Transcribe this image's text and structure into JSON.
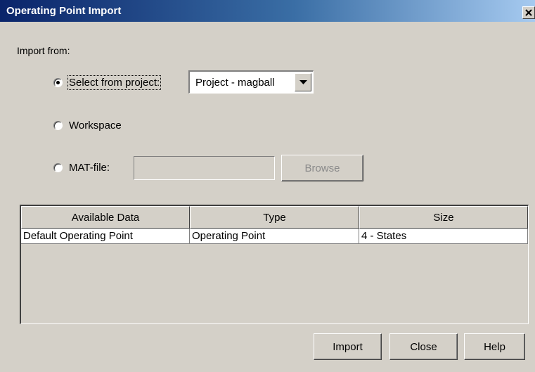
{
  "window": {
    "title": "Operating Point Import",
    "close_icon": "close-x-icon"
  },
  "import_from_label": "Import from:",
  "options": {
    "project": {
      "label": "Select from project:",
      "selected": true
    },
    "workspace": {
      "label": "Workspace",
      "selected": false
    },
    "matfile": {
      "label": "MAT-file:",
      "selected": false,
      "value": ""
    }
  },
  "project_select": {
    "value": "Project - magball",
    "arrow_icon": "chevron-down-icon"
  },
  "browse_button": {
    "label": "Browse",
    "enabled": false
  },
  "table": {
    "columns": [
      "Available Data",
      "Type",
      "Size"
    ],
    "rows": [
      [
        "Default Operating Point",
        "Operating Point",
        "4 - States"
      ]
    ]
  },
  "buttons": {
    "import": "Import",
    "close": "Close",
    "help": "Help"
  },
  "colors": {
    "dialog_bg": "#d4d0c8",
    "title_start": "#0a246a",
    "title_end": "#a6caf0"
  }
}
